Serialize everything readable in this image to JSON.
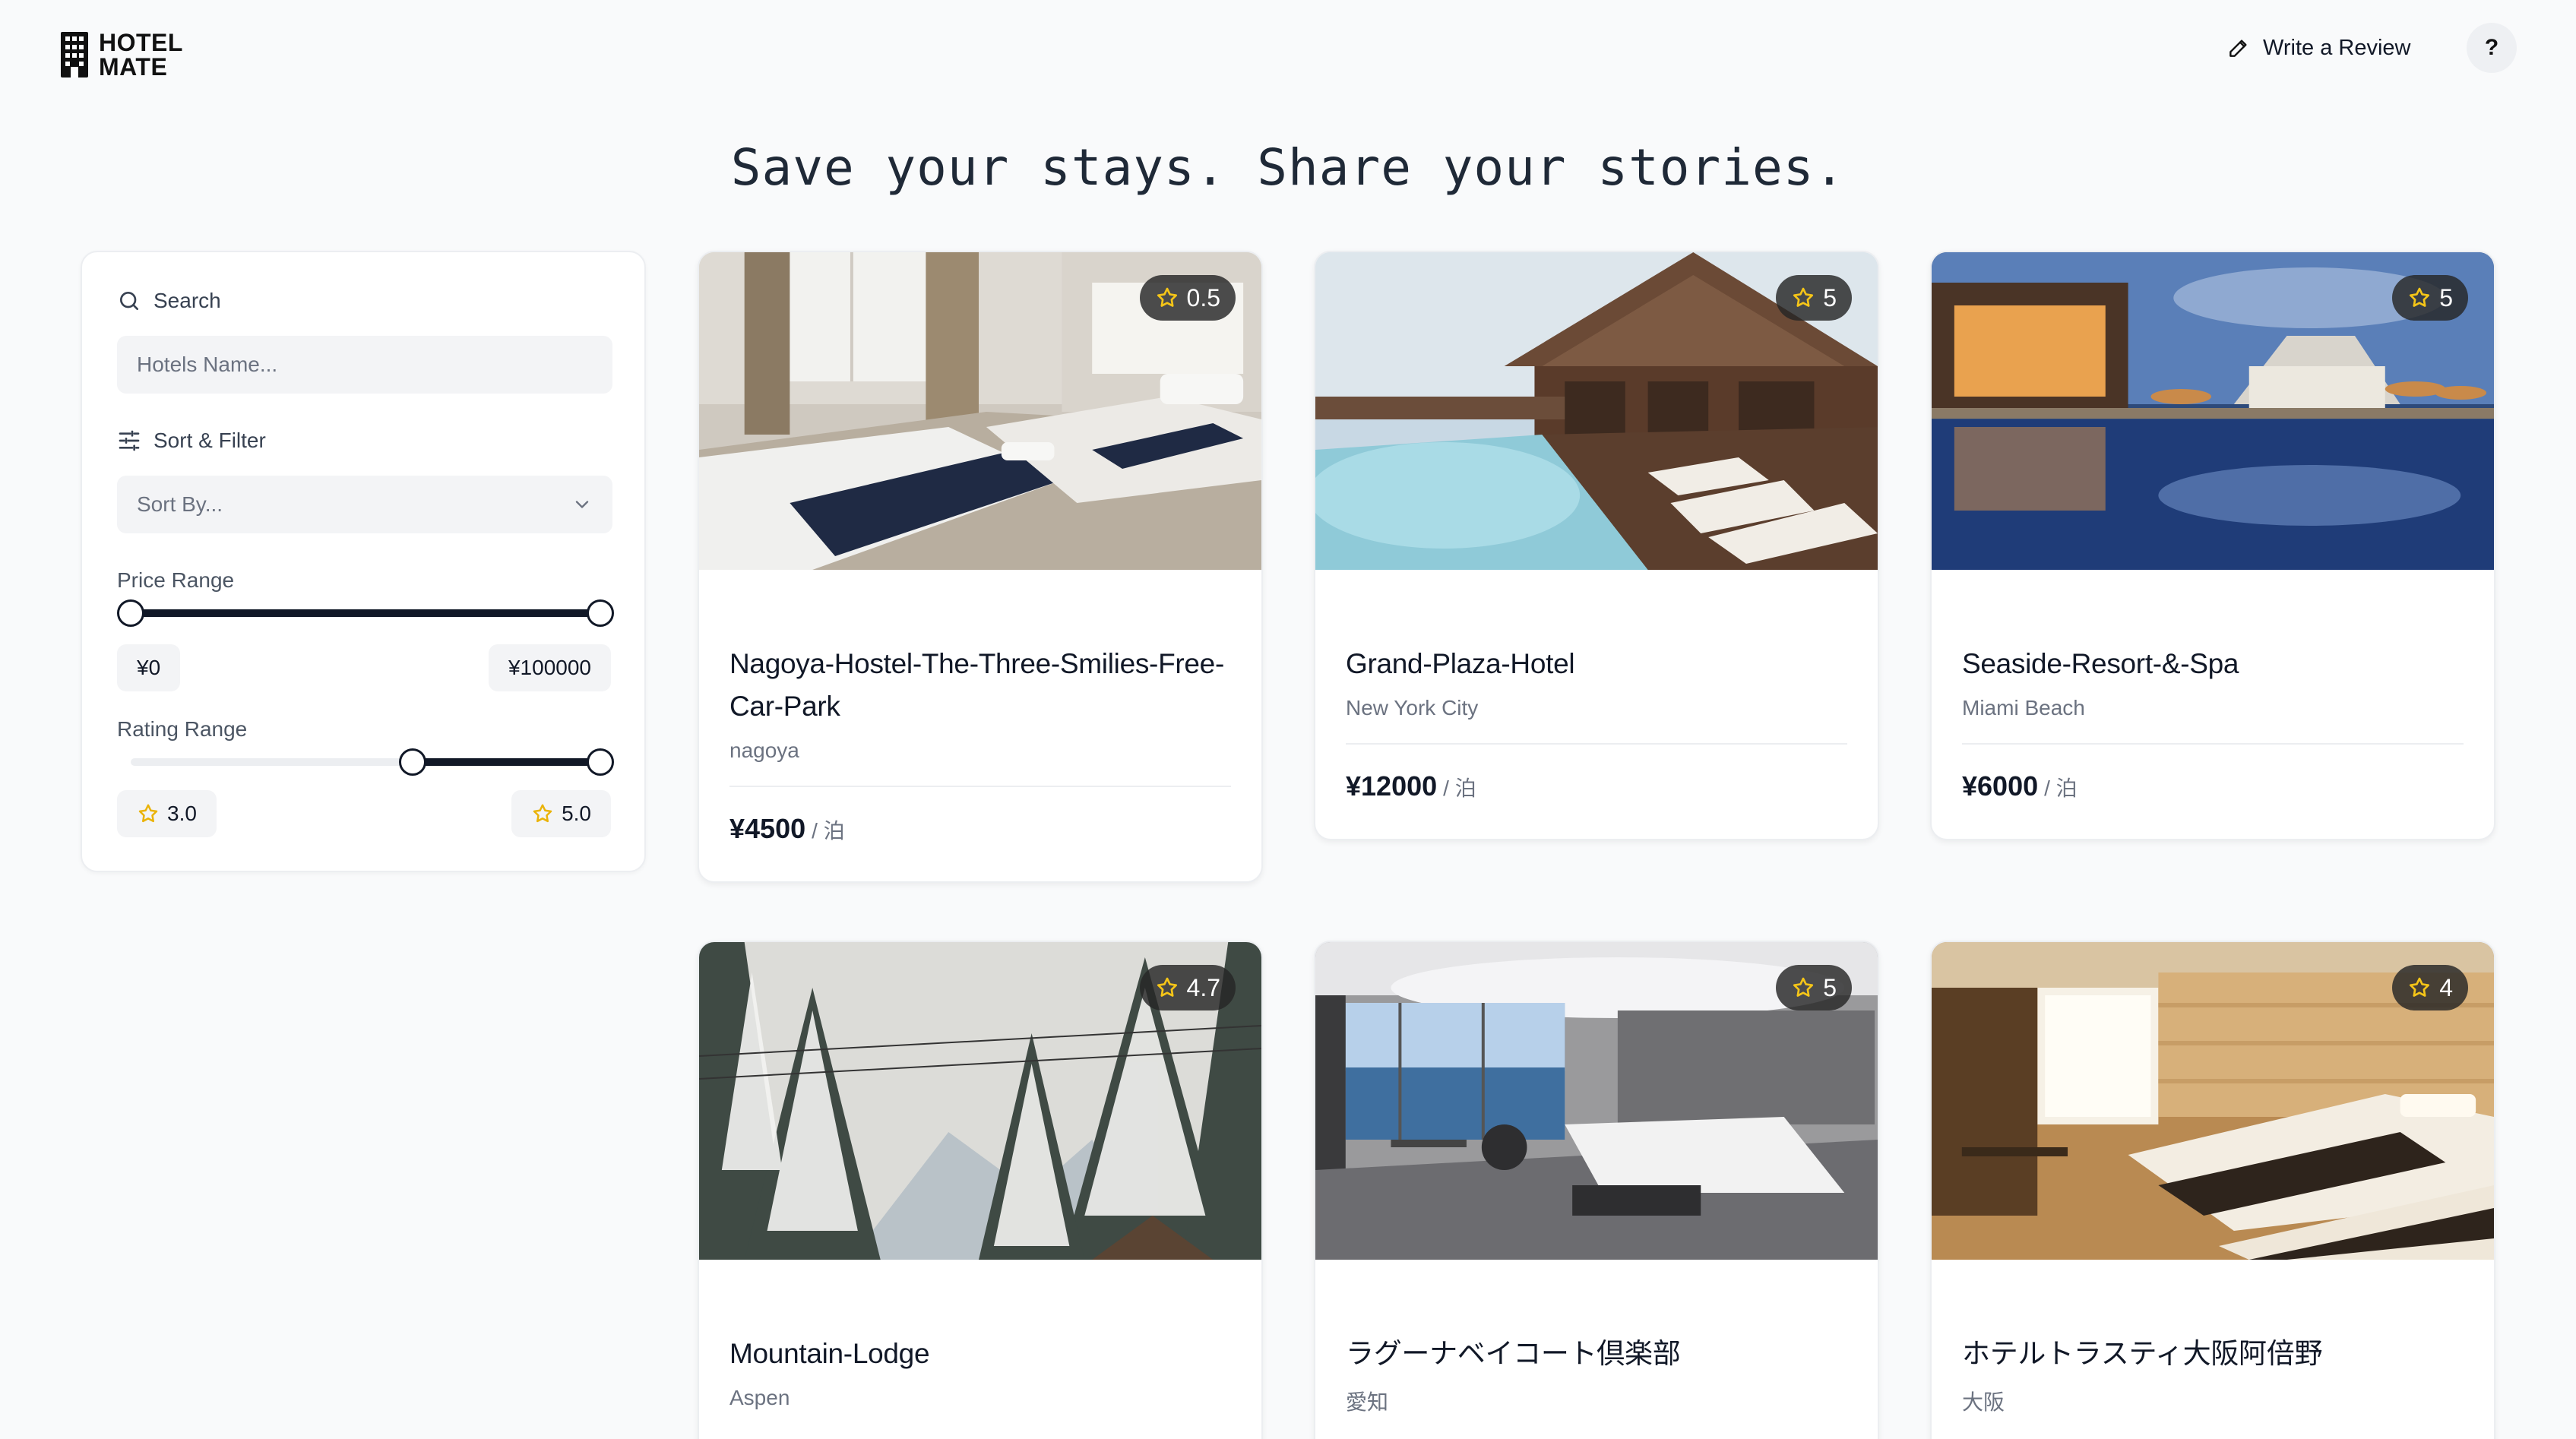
{
  "brand": {
    "line1": "HOTEL",
    "line2": "MATE"
  },
  "header": {
    "write_review_label": "Write a Review",
    "help_label": "?"
  },
  "tagline": "Save your stays. Share your stories.",
  "sidebar": {
    "search_label": "Search",
    "search_placeholder": "Hotels Name...",
    "sort_filter_label": "Sort & Filter",
    "sort_placeholder": "Sort By...",
    "price_range": {
      "label": "Price Range",
      "min_label": "¥0",
      "max_label": "¥100000",
      "min_value": 0,
      "max_value": 100000,
      "range": [
        0,
        100000
      ]
    },
    "rating_range": {
      "label": "Rating Range",
      "min_label": "3.0",
      "max_label": "5.0",
      "min_value": 3.0,
      "max_value": 5.0,
      "range": [
        0,
        5
      ]
    }
  },
  "price_unit": "/ 泊",
  "hotels": [
    {
      "name": "Nagoya-Hostel-The-Three-Smilies-Free-Car-Park",
      "location": "nagoya",
      "price": "¥4500",
      "rating": "0.5",
      "image": "hostel-room-photo"
    },
    {
      "name": "Grand-Plaza-Hotel",
      "location": "New York City",
      "price": "¥12000",
      "rating": "5",
      "image": "resort-pool-photo"
    },
    {
      "name": "Seaside-Resort-&-Spa",
      "location": "Miami Beach",
      "price": "¥6000",
      "rating": "5",
      "image": "night-pool-photo"
    },
    {
      "name": "Mountain-Lodge",
      "location": "Aspen",
      "price": "",
      "rating": "4.7",
      "image": "snowy-forest-photo"
    },
    {
      "name": "ラグーナベイコート倶楽部",
      "location": "愛知",
      "price": "",
      "rating": "5",
      "image": "ocean-view-suite-photo"
    },
    {
      "name": "ホテルトラスティ大阪阿倍野",
      "location": "大阪",
      "price": "",
      "rating": "4",
      "image": "twin-room-photo"
    }
  ],
  "colors": {
    "accent": "#111827",
    "star": "#f5c518",
    "background": "#f9fafb"
  }
}
